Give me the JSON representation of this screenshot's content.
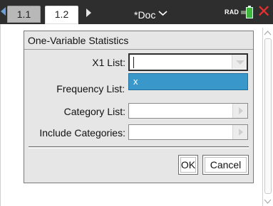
{
  "tabs": {
    "items": [
      {
        "label": "1.1"
      },
      {
        "label": "1.2"
      }
    ],
    "document": "*Doc",
    "angle_mode": "RAD"
  },
  "dialog": {
    "title": "One-Variable Statistics",
    "fields": {
      "x1_list": {
        "label": "X1 List:",
        "value": ""
      },
      "frequency_list": {
        "label": "Frequency List:",
        "value": ""
      },
      "category_list": {
        "label": "Category List:",
        "value": ""
      },
      "include_categories": {
        "label": "Include Categories:",
        "value": ""
      }
    },
    "dropdown_options": [
      "x"
    ],
    "buttons": {
      "ok": "OK",
      "cancel": "Cancel"
    }
  },
  "colors": {
    "topbar": "#2e2e2e",
    "dropdown_highlight": "#3a97c9",
    "dialog_background": "#e6e6e6",
    "close_icon": "#e53030",
    "battery": "#3db83d"
  }
}
